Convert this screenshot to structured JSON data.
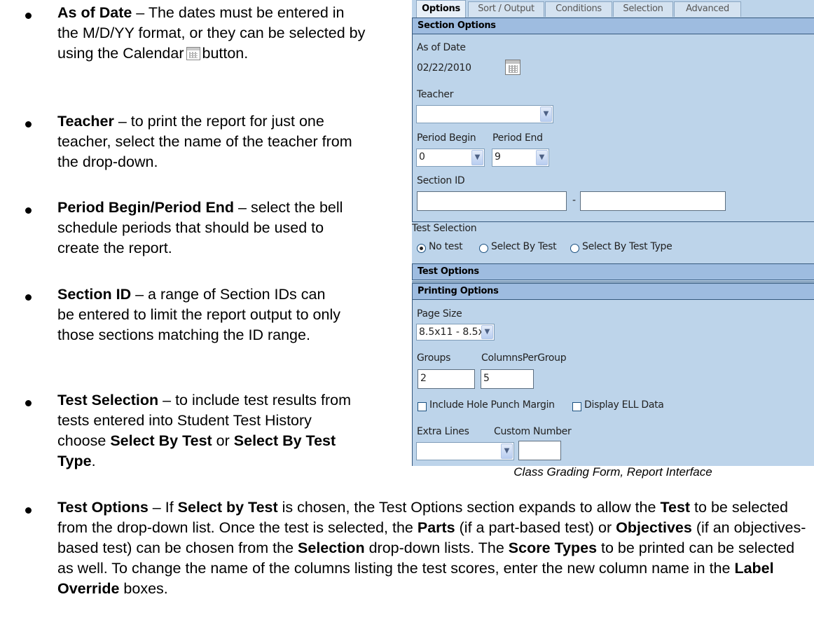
{
  "bullets": [
    {
      "title": "As of Date",
      "pre_icon": " – The dates must be entered in the M/D/YY format, or they can be selected by using the Calendar",
      "icon": "calendar-icon",
      "post_icon": "button."
    },
    {
      "title": "Teacher",
      "text": " – to print the report for just one teacher, select the name of the teacher from the drop-down."
    },
    {
      "title": "Period Begin/Period End",
      "text": " – select the bell schedule periods that should be used to create the report."
    },
    {
      "title": "Section ID",
      "text": " – a range of Section IDs can be entered to limit the report output to only those sections matching the ID range."
    },
    {
      "title": "Test Selection",
      "text": " – to include test results from tests entered into Student Test History choose ",
      "bold1": "Select By Test",
      "mid": " or ",
      "bold2": "Select By Test Type",
      "end": "."
    },
    {
      "title": "Test Options",
      "text_runs": [
        {
          "t": " – If ",
          "b": false
        },
        {
          "t": "Select by Test",
          "b": true
        },
        {
          "t": " is chosen, the Test Options section expands to allow the ",
          "b": false
        },
        {
          "t": "Test",
          "b": true
        },
        {
          "t": " to be selected from the drop-down list.  Once the test is selected, the ",
          "b": false
        },
        {
          "t": "Parts",
          "b": true
        },
        {
          "t": " (if a part-based test) or ",
          "b": false
        },
        {
          "t": "Objectives",
          "b": true
        },
        {
          "t": " (if an objectives-based test) can be chosen from the ",
          "b": false
        },
        {
          "t": "Selection",
          "b": true
        },
        {
          "t": " drop-down lists.  The ",
          "b": false
        },
        {
          "t": "Score Types",
          "b": true
        },
        {
          "t": " to be printed can be selected as well.  To change the name of the columns listing the test scores, enter the new column name in the ",
          "b": false
        },
        {
          "t": "Label Override",
          "b": true
        },
        {
          "t": " boxes.",
          "b": false
        }
      ]
    }
  ],
  "panel": {
    "tabs": [
      "Options",
      "Sort / Output",
      "Conditions",
      "Selection",
      "Advanced"
    ],
    "active_tab": "Options",
    "section_options": "Section Options",
    "as_of_date_label": "As of Date",
    "as_of_date_value": "02/22/2010",
    "teacher_label": "Teacher",
    "teacher_value": "",
    "period_begin_label": "Period Begin",
    "period_end_label": "Period End",
    "period_begin_value": "0",
    "period_end_value": "9",
    "section_id_label": "Section ID",
    "section_id_from": "",
    "section_id_to": "",
    "section_id_dash": "-",
    "test_selection_label": "Test Selection",
    "radio_no_test": "No test",
    "radio_by_test": "Select By Test",
    "radio_by_type": "Select By Test Type",
    "selected_radio": "No test",
    "test_options": "Test Options",
    "printing_options": "Printing Options",
    "page_size_label": "Page Size",
    "page_size_value": "8.5x11 - 8.5x'",
    "groups_label": "Groups",
    "columns_label": "ColumnsPerGroup",
    "groups_value": "2",
    "columns_value": "5",
    "hole_punch_label": "Include Hole Punch Margin",
    "ell_label": "Display ELL Data",
    "extra_lines_label": "Extra Lines",
    "custom_number_label": "Custom Number",
    "extra_lines_value": "",
    "custom_number_value": ""
  },
  "caption": "Class Grading Form, Report Interface",
  "colors": {
    "panel_bg": "#bdd4ea",
    "section_header": "#9ebce0"
  }
}
